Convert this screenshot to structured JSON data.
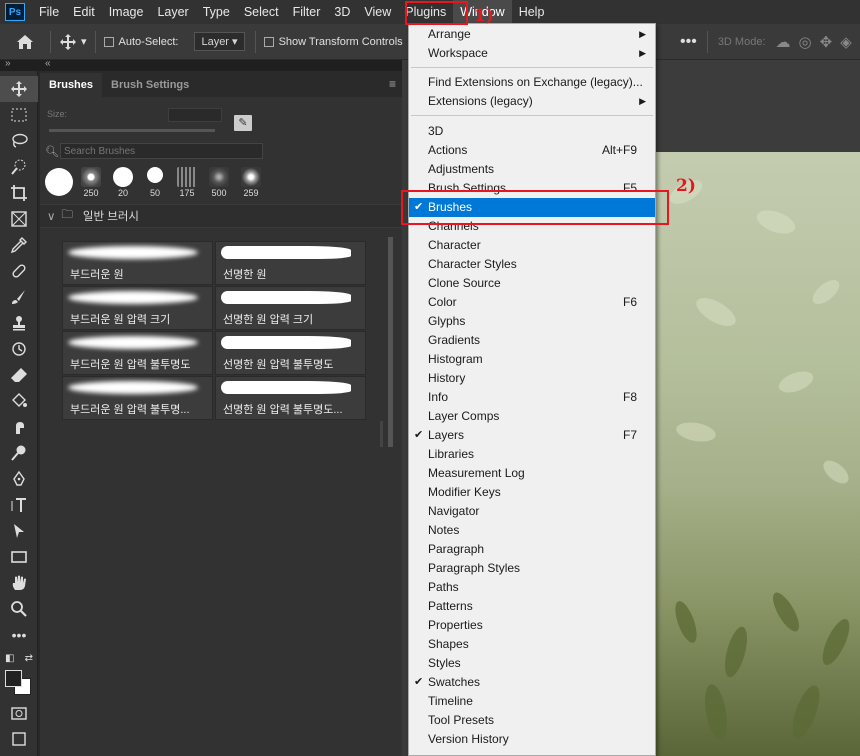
{
  "menubar": {
    "logo": "Ps",
    "items": [
      "File",
      "Edit",
      "Image",
      "Layer",
      "Type",
      "Select",
      "Filter",
      "3D",
      "View",
      "Plugins",
      "Window",
      "Help"
    ]
  },
  "optbar": {
    "auto_select": "Auto-Select:",
    "layer_dropdown": "Layer",
    "show_transform": "Show Transform Controls",
    "mode_3d": "3D Mode:"
  },
  "brushes_panel": {
    "tabs": [
      "Brushes",
      "Brush Settings"
    ],
    "size_label": "Size:",
    "search_placeholder": "Search Brushes",
    "presets": [
      "",
      "250",
      "20",
      "50",
      "175",
      "500",
      "259"
    ],
    "group_name": "일반 브러시",
    "brushes": [
      "부드러운 원",
      "선명한 원",
      "부드러운 원 압력 크기",
      "선명한 원 압력 크기",
      "부드러운 원 압력 불투명도",
      "선명한 원 압력 불투명도",
      "부드러운 원 압력 불투명...",
      "선명한 원 압력 불투명도..."
    ]
  },
  "window_menu": {
    "items": [
      {
        "label": "Arrange",
        "sub": true
      },
      {
        "label": "Workspace",
        "sub": true
      },
      {
        "sep": true
      },
      {
        "label": "Find Extensions on Exchange (legacy)..."
      },
      {
        "label": "Extensions (legacy)",
        "sub": true
      },
      {
        "sep": true
      },
      {
        "label": "3D"
      },
      {
        "label": "Actions",
        "shortcut": "Alt+F9"
      },
      {
        "label": "Adjustments"
      },
      {
        "label": "Brush Settings",
        "shortcut": "F5"
      },
      {
        "label": "Brushes",
        "checked": true,
        "highlighted": true
      },
      {
        "label": "Channels"
      },
      {
        "label": "Character"
      },
      {
        "label": "Character Styles"
      },
      {
        "label": "Clone Source"
      },
      {
        "label": "Color",
        "shortcut": "F6"
      },
      {
        "label": "Glyphs"
      },
      {
        "label": "Gradients"
      },
      {
        "label": "Histogram"
      },
      {
        "label": "History"
      },
      {
        "label": "Info",
        "shortcut": "F8"
      },
      {
        "label": "Layer Comps"
      },
      {
        "label": "Layers",
        "shortcut": "F7",
        "checked": true
      },
      {
        "label": "Libraries"
      },
      {
        "label": "Measurement Log"
      },
      {
        "label": "Modifier Keys"
      },
      {
        "label": "Navigator"
      },
      {
        "label": "Notes"
      },
      {
        "label": "Paragraph"
      },
      {
        "label": "Paragraph Styles"
      },
      {
        "label": "Paths"
      },
      {
        "label": "Patterns"
      },
      {
        "label": "Properties"
      },
      {
        "label": "Shapes"
      },
      {
        "label": "Styles"
      },
      {
        "label": "Swatches",
        "checked": true
      },
      {
        "label": "Timeline"
      },
      {
        "label": "Tool Presets"
      },
      {
        "label": "Version History"
      }
    ]
  },
  "annotations": {
    "step1": "1)",
    "step2": "2)"
  },
  "colors": {
    "highlight": "#0078d7",
    "annotation": "#e8161f",
    "canvas": "#b4bf9c"
  }
}
